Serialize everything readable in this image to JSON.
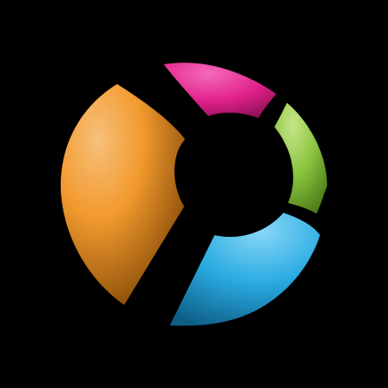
{
  "icon": {
    "name": "segmented-ring-logo-icon",
    "background": "#000000",
    "segments": [
      {
        "name": "orange-segment",
        "color": "#F29A2E"
      },
      {
        "name": "magenta-segment",
        "color": "#E0218A"
      },
      {
        "name": "green-segment",
        "color": "#8BC53F"
      },
      {
        "name": "blue-segment",
        "color": "#29ABE2"
      }
    ]
  }
}
